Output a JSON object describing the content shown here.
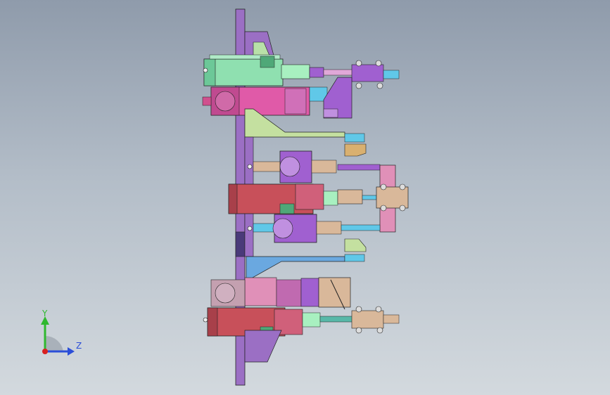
{
  "viewport": {
    "background_top": "#8f9bab",
    "background_bottom": "#d3d9de"
  },
  "triad": {
    "y_label": "Y",
    "z_label": "Z",
    "y_color": "#2fb82f",
    "z_color": "#2b4ed8",
    "x_color": "#d82020"
  },
  "palette": {
    "plate": "#9b6fc4",
    "green": "#8fe0b0",
    "pink": "#e05aa8",
    "red": "#c8505a",
    "purple": "#a060d0",
    "blue": "#6aa8e0",
    "cyan": "#60c8e8",
    "tan": "#d9b89a",
    "lime": "#c4e0a0",
    "teal": "#58b8a8"
  }
}
